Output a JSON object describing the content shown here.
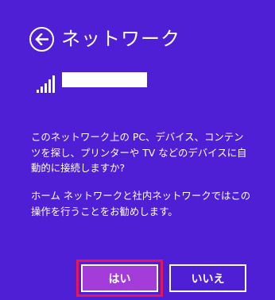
{
  "header": {
    "title": "ネットワーク",
    "back_icon": "back-arrow-icon"
  },
  "network": {
    "signal_icon": "wifi-signal-icon",
    "ssid": ""
  },
  "message": {
    "line1": "このネットワーク上の PC、デバイス、コンテン",
    "line2": "ツを探し、プリンターや TV などのデバイスに自",
    "line3": "動的に接続しますか?",
    "line4": "ホーム ネットワークと社内ネットワークではこの",
    "line5": "操作を行うことをお勧めします。"
  },
  "buttons": {
    "yes_label": "はい",
    "no_label": "いいえ"
  },
  "colors": {
    "background": "#4F1FD6",
    "yes_button": "#A33CD9",
    "highlight": "#E5175A",
    "text": "#FFFFFF"
  }
}
